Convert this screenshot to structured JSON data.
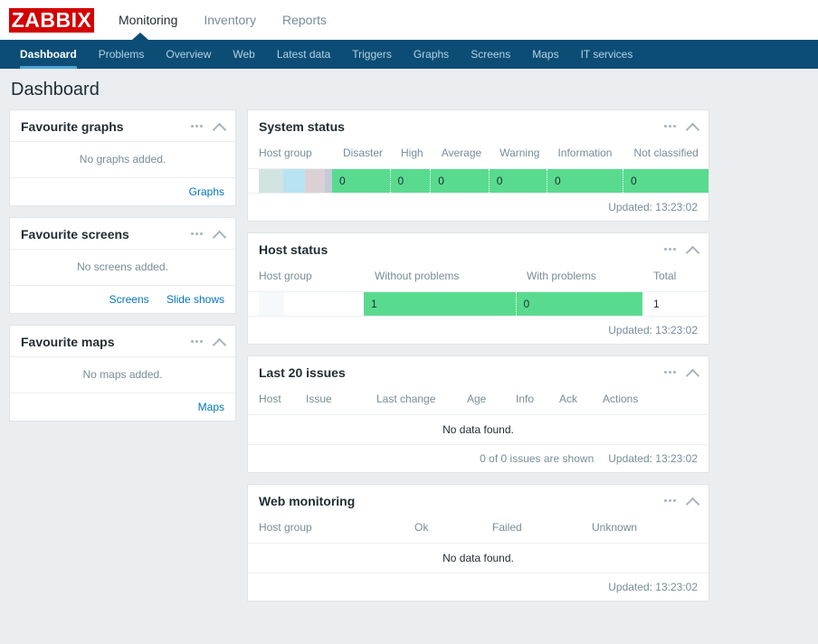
{
  "brand": {
    "logo_text": "ZABBIX",
    "logo_color": "#d40000"
  },
  "topnav": {
    "items": [
      {
        "label": "Monitoring",
        "active": true
      },
      {
        "label": "Inventory",
        "active": false
      },
      {
        "label": "Reports",
        "active": false
      }
    ]
  },
  "subnav": {
    "items": [
      {
        "label": "Dashboard",
        "active": true
      },
      {
        "label": "Problems",
        "active": false
      },
      {
        "label": "Overview",
        "active": false
      },
      {
        "label": "Web",
        "active": false
      },
      {
        "label": "Latest data",
        "active": false
      },
      {
        "label": "Triggers",
        "active": false
      },
      {
        "label": "Graphs",
        "active": false
      },
      {
        "label": "Screens",
        "active": false
      },
      {
        "label": "Maps",
        "active": false
      },
      {
        "label": "IT services",
        "active": false
      }
    ]
  },
  "page": {
    "title": "Dashboard"
  },
  "theme": {
    "green": "#59db8f",
    "link": "#0275b8",
    "nav_bg": "#0c4d76",
    "accent": "#4ea3d6"
  },
  "widgets": {
    "favourite_graphs": {
      "title": "Favourite graphs",
      "empty": "No graphs added.",
      "links": [
        "Graphs"
      ]
    },
    "favourite_screens": {
      "title": "Favourite screens",
      "empty": "No screens added.",
      "links": [
        "Screens",
        "Slide shows"
      ]
    },
    "favourite_maps": {
      "title": "Favourite maps",
      "empty": "No maps added.",
      "links": [
        "Maps"
      ]
    },
    "system_status": {
      "title": "System status",
      "columns": [
        "Host group",
        "Disaster",
        "High",
        "Average",
        "Warning",
        "Information",
        "Not classified"
      ],
      "row": {
        "host_group": "",
        "values": [
          "0",
          "0",
          "0",
          "0",
          "0",
          "0"
        ]
      },
      "updated": "Updated: 13:23:02"
    },
    "host_status": {
      "title": "Host status",
      "columns": [
        "Host group",
        "Without problems",
        "With problems",
        "Total"
      ],
      "row": {
        "host_group": "",
        "without_problems": "1",
        "with_problems": "0",
        "total": "1"
      },
      "updated": "Updated: 13:23:02"
    },
    "last_issues": {
      "title": "Last 20 issues",
      "columns": [
        "Host",
        "Issue",
        "Last change",
        "Age",
        "Info",
        "Ack",
        "Actions"
      ],
      "empty": "No data found.",
      "shown": "0 of 0 issues are shown",
      "updated": "Updated: 13:23:02"
    },
    "web_monitoring": {
      "title": "Web monitoring",
      "columns": [
        "Host group",
        "Ok",
        "Failed",
        "Unknown"
      ],
      "empty": "No data found.",
      "updated": "Updated: 13:23:02"
    }
  }
}
